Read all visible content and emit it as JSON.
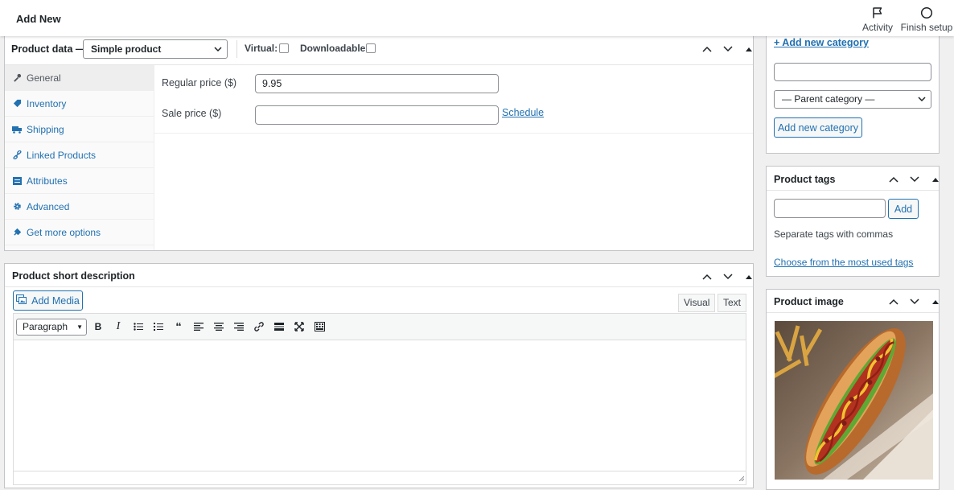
{
  "header": {
    "title": "Add New",
    "activity_label": "Activity",
    "finish_setup_label": "Finish setup"
  },
  "product_data": {
    "title": "Product data —",
    "type_select": "Simple product",
    "virtual_label": "Virtual:",
    "downloadable_label": "Downloadable:",
    "tabs": [
      {
        "label": "General",
        "icon": "wrench-icon"
      },
      {
        "label": "Inventory",
        "icon": "tag-icon"
      },
      {
        "label": "Shipping",
        "icon": "truck-icon"
      },
      {
        "label": "Linked Products",
        "icon": "link-icon"
      },
      {
        "label": "Attributes",
        "icon": "list-icon"
      },
      {
        "label": "Advanced",
        "icon": "gear-icon"
      },
      {
        "label": "Get more options",
        "icon": "plugin-icon"
      }
    ],
    "regular_price_label": "Regular price ($)",
    "regular_price_value": "9.95",
    "sale_price_label": "Sale price ($)",
    "sale_price_value": "",
    "schedule_link": "Schedule"
  },
  "short_description": {
    "title": "Product short description",
    "add_media": "Add Media",
    "tab_visual": "Visual",
    "tab_text": "Text",
    "format_select": "Paragraph",
    "content": ""
  },
  "categories": {
    "add_new_link": "+ Add new category",
    "new_category_value": "",
    "parent_select": "— Parent category —",
    "add_button": "Add new category"
  },
  "tags": {
    "title": "Product tags",
    "input_value": "",
    "add_button": "Add",
    "help_text": "Separate tags with commas",
    "choose_link": "Choose from the most used tags"
  },
  "image": {
    "title": "Product image",
    "alt": "Hot dog with toppings"
  },
  "colors": {
    "accent": "#2271b1",
    "border": "#c3c4c7",
    "bg": "#f0f0f1"
  }
}
